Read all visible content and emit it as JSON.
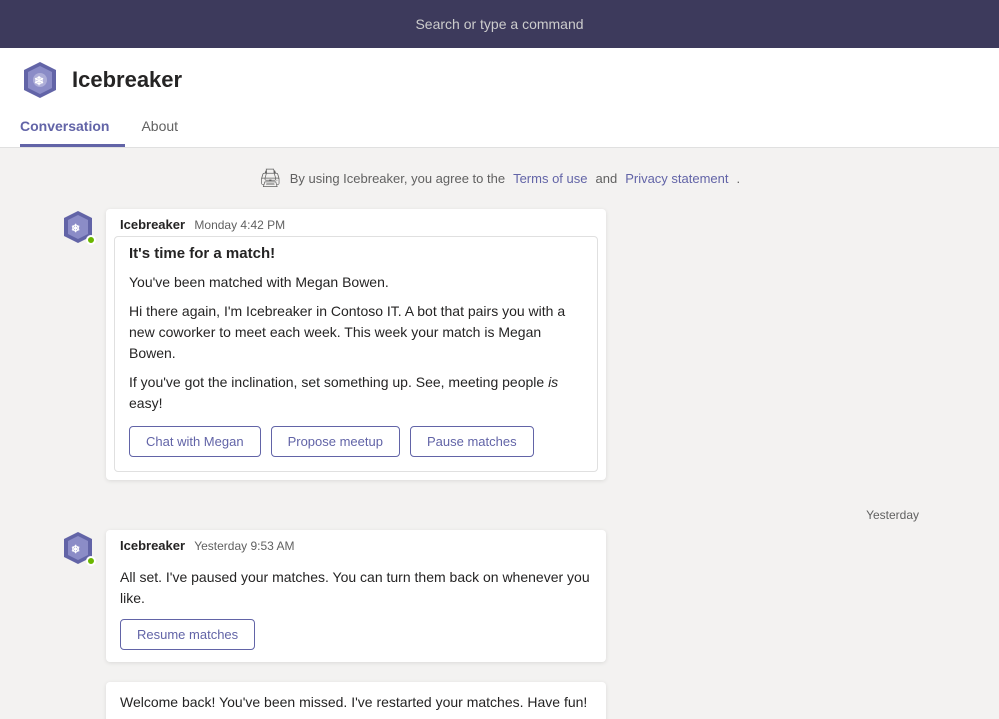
{
  "topbar": {
    "placeholder": "Search or type a command"
  },
  "header": {
    "app_name": "Icebreaker",
    "tabs": [
      {
        "id": "conversation",
        "label": "Conversation",
        "active": true
      },
      {
        "id": "about",
        "label": "About",
        "active": false
      }
    ]
  },
  "terms": {
    "prefix": "By using Icebreaker, you agree to the",
    "terms_link": "Terms of use",
    "middle": "and",
    "privacy_link": "Privacy statement",
    "suffix": "."
  },
  "messages": [
    {
      "id": "msg1",
      "sender": "Icebreaker",
      "timestamp": "Monday 4:42 PM",
      "card": {
        "heading": "It's time for a match!",
        "paragraphs": [
          "You've been matched with Megan Bowen.",
          "Hi there again, I'm Icebreaker in Contoso IT. A bot that pairs you with a new coworker to meet each week. This week your match is Megan Bowen.",
          "If you've got the inclination, set something up. See, meeting people is easy!"
        ],
        "buttons": [
          "Chat with Megan",
          "Propose meetup",
          "Pause matches"
        ]
      }
    }
  ],
  "day_separator": "Yesterday",
  "messages2": [
    {
      "id": "msg2",
      "sender": "Icebreaker",
      "timestamp": "Yesterday 9:53 AM",
      "text": "All set. I've paused your matches. You can turn them back on whenever you like.",
      "buttons": [
        "Resume matches"
      ]
    }
  ],
  "partial_message": {
    "text": "Welcome back! You've been missed. I've restarted your matches. Have fun!"
  }
}
